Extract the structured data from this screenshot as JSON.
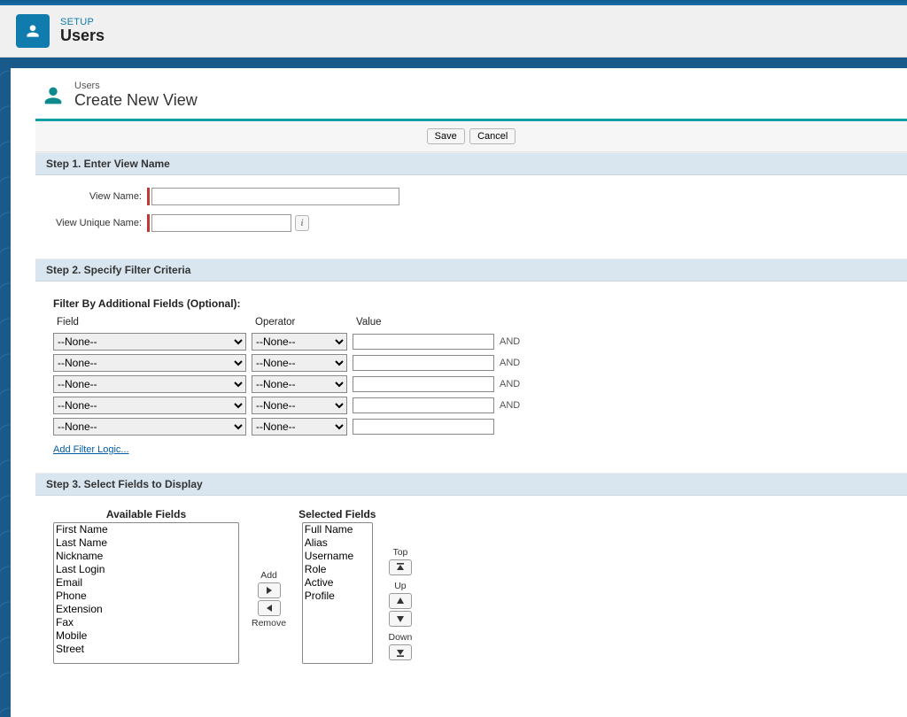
{
  "header": {
    "eyebrow": "SETUP",
    "title": "Users"
  },
  "page": {
    "crumb": "Users",
    "title": "Create New View"
  },
  "buttons": {
    "save": "Save",
    "cancel": "Cancel"
  },
  "step1": {
    "bar": "Step 1. Enter View Name",
    "view_name_label": "View Name:",
    "view_name_value": "",
    "unique_name_label": "View Unique Name:",
    "unique_name_value": "",
    "info_glyph": "i"
  },
  "step2": {
    "bar": "Step 2. Specify Filter Criteria",
    "caption": "Filter By Additional Fields (Optional):",
    "col_field": "Field",
    "col_operator": "Operator",
    "col_value": "Value",
    "none_option": "--None--",
    "and_label": "AND",
    "add_logic": "Add Filter Logic...",
    "rows": [
      {
        "field": "--None--",
        "op": "--None--",
        "val": "",
        "and": true
      },
      {
        "field": "--None--",
        "op": "--None--",
        "val": "",
        "and": true
      },
      {
        "field": "--None--",
        "op": "--None--",
        "val": "",
        "and": true
      },
      {
        "field": "--None--",
        "op": "--None--",
        "val": "",
        "and": true
      },
      {
        "field": "--None--",
        "op": "--None--",
        "val": "",
        "and": false
      }
    ]
  },
  "step3": {
    "bar": "Step 3. Select Fields to Display",
    "available_title": "Available Fields",
    "selected_title": "Selected Fields",
    "available": [
      "First Name",
      "Last Name",
      "Nickname",
      "Last Login",
      "Email",
      "Phone",
      "Extension",
      "Fax",
      "Mobile",
      "Street"
    ],
    "selected": [
      "Full Name",
      "Alias",
      "Username",
      "Role",
      "Active",
      "Profile"
    ],
    "add_label": "Add",
    "remove_label": "Remove",
    "top_label": "Top",
    "up_label": "Up",
    "down_label": "Down"
  }
}
